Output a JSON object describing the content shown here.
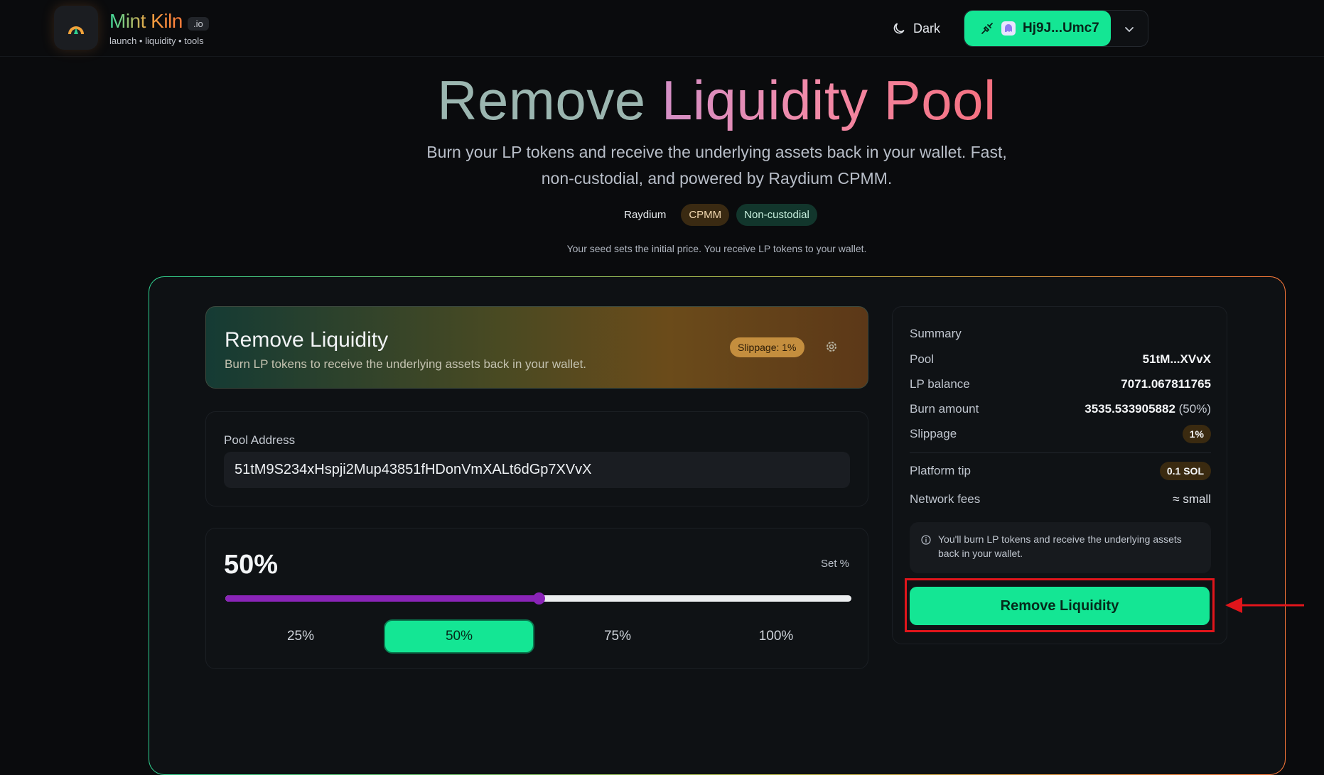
{
  "header": {
    "brand_name": "Mint Kiln",
    "brand_tld": ".io",
    "tagline": "launch • liquidity • tools",
    "theme_label": "Dark",
    "wallet_label": "Hj9J...Umc7"
  },
  "hero": {
    "title_part1": "Remove",
    "title_part2": "Liquidity Pool",
    "subtitle": "Burn your LP tokens and receive the underlying assets back in your wallet. Fast, non-custodial, and powered by Raydium CPMM.",
    "chips": [
      "Raydium",
      "CPMM",
      "Non-custodial"
    ],
    "note": "Your seed sets the initial price. You receive LP tokens to your wallet."
  },
  "panel": {
    "title": "Remove Liquidity",
    "subtitle": "Burn LP tokens to receive the underlying assets back in your wallet.",
    "slippage_badge": "Slippage: 1%"
  },
  "pool": {
    "label": "Pool Address",
    "value": "51tM9S234xHspji2Mup43851fHDonVmXALt6dGp7XVvX"
  },
  "percent": {
    "value_label": "50%",
    "value": 50,
    "set_label": "Set %",
    "options": [
      "25%",
      "50%",
      "75%",
      "100%"
    ],
    "active_option": "50%"
  },
  "summary": {
    "heading": "Summary",
    "pool_label": "Pool",
    "pool_value": "51tM...XVvX",
    "lp_balance_label": "LP balance",
    "lp_balance_value": "7071.067811765",
    "burn_label": "Burn amount",
    "burn_value": "3535.533905882",
    "burn_pct": "(50%)",
    "slippage_label": "Slippage",
    "slippage_value": "1%",
    "tip_label": "Platform tip",
    "tip_value": "0.1 SOL",
    "fees_label": "Network fees",
    "fees_value": "≈ small",
    "info_text": "You'll burn LP tokens and receive the underlying assets back in your wallet.",
    "button_label": "Remove Liquidity"
  },
  "colors": {
    "accent_green": "#14e694",
    "slider_purple": "#8a24b8",
    "highlight_red": "#e1151b"
  }
}
